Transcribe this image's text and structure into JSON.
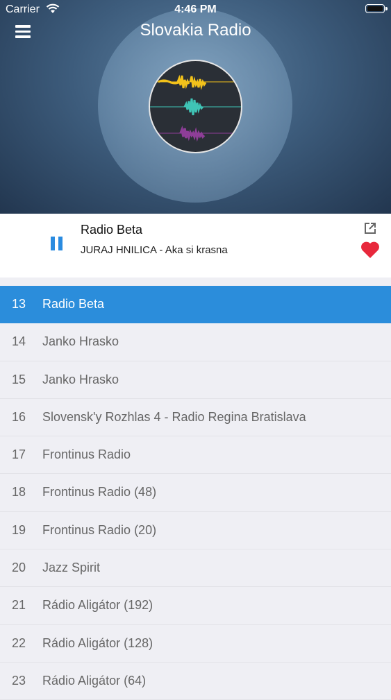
{
  "status_bar": {
    "carrier": "Carrier",
    "time": "4:46 PM"
  },
  "header": {
    "title": "Slovakia Radio"
  },
  "now_playing": {
    "station": "Radio Beta",
    "track": "JURAJ HNILICA - Aka si krasna"
  },
  "colors": {
    "accent": "#2b8ddb",
    "favorite": "#e8283c",
    "wave_top": "#f2c21b",
    "wave_mid": "#3fc4b6",
    "wave_bottom": "#8e3e98"
  },
  "stations": [
    {
      "number": "13",
      "name": "Radio Beta",
      "active": true
    },
    {
      "number": "14",
      "name": "Janko Hrasko"
    },
    {
      "number": "15",
      "name": "Janko Hrasko"
    },
    {
      "number": "16",
      "name": "Slovensk'y Rozhlas 4 - Radio Regina Bratislava"
    },
    {
      "number": "17",
      "name": "Frontinus Radio"
    },
    {
      "number": "18",
      "name": "Frontinus Radio (48)"
    },
    {
      "number": "19",
      "name": "Frontinus Radio (20)"
    },
    {
      "number": "20",
      "name": "Jazz Spirit"
    },
    {
      "number": "21",
      "name": "Rádio Aligátor (192)"
    },
    {
      "number": "22",
      "name": "Rádio Aligátor (128)"
    },
    {
      "number": "23",
      "name": "Rádio Aligátor (64)"
    }
  ]
}
